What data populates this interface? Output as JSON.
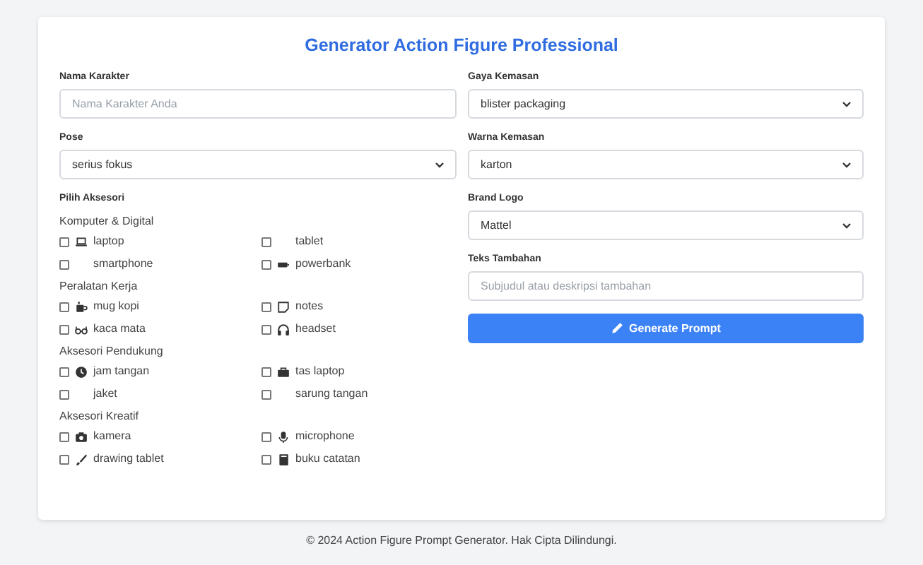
{
  "title": "Generator Action Figure Professional",
  "left_fields": [
    {
      "label": "Nama Karakter",
      "kind": "input",
      "placeholder": "Nama Karakter Anda"
    },
    {
      "label": "Pose",
      "kind": "select",
      "value": "serius fokus"
    }
  ],
  "accessories": {
    "label": "Pilih Aksesori",
    "groups": [
      {
        "heading": "Komputer & Digital",
        "items": [
          {
            "label": "laptop",
            "checked": false
          },
          {
            "label": "tablet",
            "checked": false
          },
          {
            "label": "smartphone",
            "checked": false
          },
          {
            "label": "powerbank",
            "checked": false
          }
        ]
      },
      {
        "heading": "Peralatan Kerja",
        "items": [
          {
            "label": "mug kopi",
            "checked": false
          },
          {
            "label": "notes",
            "checked": false
          },
          {
            "label": "kaca mata",
            "checked": false
          },
          {
            "label": "headset",
            "checked": false
          }
        ]
      },
      {
        "heading": "Aksesori Pendukung",
        "items": [
          {
            "label": "jam tangan",
            "checked": false
          },
          {
            "label": "tas laptop",
            "checked": false
          },
          {
            "label": "jaket",
            "checked": false
          },
          {
            "label": "sarung tangan",
            "checked": false
          }
        ]
      },
      {
        "heading": "Aksesori Kreatif",
        "items": [
          {
            "label": "kamera",
            "checked": false
          },
          {
            "label": "microphone",
            "checked": false
          },
          {
            "label": "drawing tablet",
            "checked": false
          },
          {
            "label": "buku catatan",
            "checked": false
          }
        ]
      }
    ]
  },
  "right_fields": [
    {
      "label": "Gaya Kemasan",
      "kind": "select",
      "value": "blister packaging"
    },
    {
      "label": "Warna Kemasan",
      "kind": "select",
      "value": "karton"
    },
    {
      "label": "Brand Logo",
      "kind": "select",
      "value": "Mattel"
    },
    {
      "label": "Teks Tambahan",
      "kind": "input",
      "placeholder": "Subjudul atau deskripsi tambahan"
    }
  ],
  "button": "Generate Prompt",
  "footer": "© 2024 Action Figure Prompt Generator. Hak Cipta Dilindungi."
}
